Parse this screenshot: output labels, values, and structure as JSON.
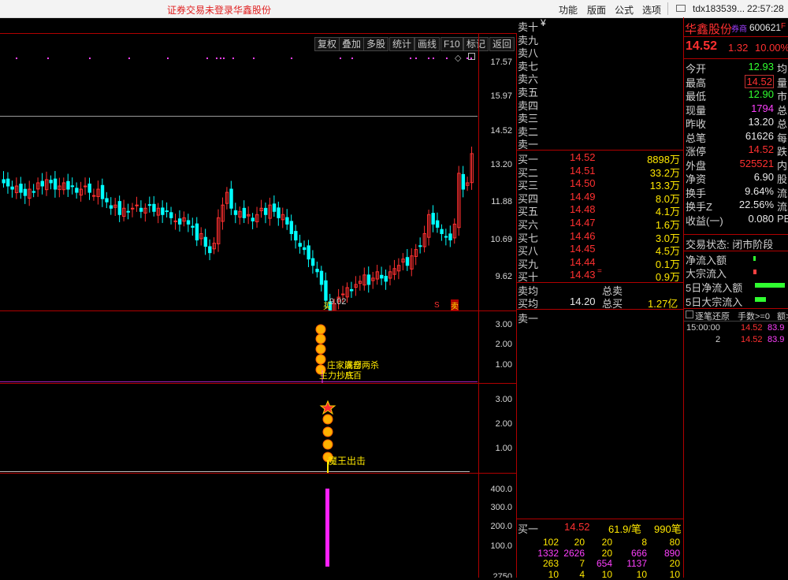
{
  "titlebar": {
    "warning": "证券交易未登录",
    "stock_name": "华鑫股份",
    "menus": [
      "功能",
      "版面",
      "公式",
      "选项"
    ],
    "account": "tdx183539...",
    "time": "22:57:28"
  },
  "toolbar": {
    "buttons": [
      "复权",
      "叠加",
      "多股",
      "统计",
      "画线",
      "F10",
      "标记",
      "返回"
    ]
  },
  "main_chart": {
    "y_ticks": [
      "17.57",
      "15.97",
      "14.52",
      "13.20",
      "11.88",
      "10.69",
      "9.62"
    ],
    "low_label": "9.02",
    "bottom_markers": [
      "S",
      "卖"
    ],
    "bottom_left_marker": "买"
  },
  "indicator1": {
    "y_ticks": [
      "3.00",
      "2.00",
      "1.00"
    ],
    "labels": [
      "庄家满仓",
      "底部两杀",
      "主力抄底",
      "八百"
    ]
  },
  "indicator2": {
    "y_ticks": [
      "3.00",
      "2.00",
      "1.00"
    ],
    "label": "魔王出击"
  },
  "volume": {
    "y_ticks": [
      "400.0",
      "300.0",
      "200.0",
      "100.0"
    ],
    "bottom_tick": "2750"
  },
  "orderbook": {
    "sell": [
      {
        "label": "卖十",
        "price": "",
        "vol": ""
      },
      {
        "label": "卖九",
        "price": "",
        "vol": ""
      },
      {
        "label": "卖八",
        "price": "",
        "vol": ""
      },
      {
        "label": "卖七",
        "price": "",
        "vol": ""
      },
      {
        "label": "卖六",
        "price": "",
        "vol": ""
      },
      {
        "label": "卖五",
        "price": "",
        "vol": ""
      },
      {
        "label": "卖四",
        "price": "",
        "vol": ""
      },
      {
        "label": "卖三",
        "price": "",
        "vol": ""
      },
      {
        "label": "卖二",
        "price": "",
        "vol": ""
      },
      {
        "label": "卖一",
        "price": "",
        "vol": ""
      }
    ],
    "sell_yen": "¥",
    "buy": [
      {
        "label": "买一",
        "price": "14.52",
        "vol": "8898万"
      },
      {
        "label": "买二",
        "price": "14.51",
        "vol": "33.2万"
      },
      {
        "label": "买三",
        "price": "14.50",
        "vol": "13.3万"
      },
      {
        "label": "买四",
        "price": "14.49",
        "vol": "8.0万"
      },
      {
        "label": "买五",
        "price": "14.48",
        "vol": "4.1万"
      },
      {
        "label": "买六",
        "price": "14.47",
        "vol": "1.6万"
      },
      {
        "label": "买七",
        "price": "14.46",
        "vol": "3.0万"
      },
      {
        "label": "买八",
        "price": "14.45",
        "vol": "4.5万"
      },
      {
        "label": "买九",
        "price": "14.44",
        "vol": "0.1万"
      },
      {
        "label": "买十",
        "price": "14.43",
        "vol": "0.9万",
        "flag": "="
      }
    ],
    "avg_sell_label": "卖均",
    "total_sell_label": "总卖",
    "avg_buy_label": "买均",
    "avg_buy_price": "14.20",
    "total_buy_label": "总买",
    "total_buy_value": "1.27亿",
    "queue_sell_label": "卖一",
    "queue_buy_label": "买一",
    "queue_buy_price": "14.52",
    "queue_buy_avg": "61.9/笔",
    "queue_buy_count": "990笔",
    "queue_rows": [
      [
        "102",
        "20",
        "20",
        "8",
        "80"
      ],
      [
        "1332",
        "2626",
        "20",
        "666",
        "890"
      ],
      [
        "263",
        "7",
        "654",
        "1137",
        "20"
      ],
      [
        "10",
        "4",
        "10",
        "10",
        "10"
      ]
    ]
  },
  "quote": {
    "name": "华鑫股份",
    "tag": "券商",
    "code": "600621",
    "code_suffix": "F",
    "price": "14.52",
    "change": "1.32",
    "pct": "10.00%",
    "rows": [
      {
        "label": "今开",
        "value": "12.93",
        "tail": "均"
      },
      {
        "label": "最高",
        "value": "14.52",
        "tail": "量"
      },
      {
        "label": "最低",
        "value": "12.90",
        "tail": "市"
      },
      {
        "label": "现量",
        "value": "1794",
        "tail": "总"
      },
      {
        "label": "昨收",
        "value": "13.20",
        "tail": "总"
      },
      {
        "label": "总笔",
        "value": "61626",
        "tail": "每"
      },
      {
        "label": "涨停",
        "value": "14.52",
        "tail": "跌"
      },
      {
        "label": "外盘",
        "value": "525521",
        "tail": "内"
      },
      {
        "label": "净资",
        "value": "6.90",
        "tail": "股"
      },
      {
        "label": "换手",
        "value": "9.64%",
        "tail": "流"
      },
      {
        "label": "换手Z",
        "value": "22.56%",
        "tail": "流"
      },
      {
        "label": "收益(一)",
        "value": "0.080",
        "tail": "PE"
      }
    ],
    "trade_status": "交易状态: 闭市阶段",
    "flows": [
      "净流入额",
      "大宗流入",
      "5日净流入额",
      "5日大宗流入"
    ],
    "tick_header": [
      "逐笔还原",
      "手数>=0",
      "额>"
    ],
    "ticks": [
      {
        "time": "15:00:00",
        "price": "14.52",
        "extra": "83.9"
      },
      {
        "time": "2",
        "price": "14.52",
        "extra": "83.9"
      }
    ]
  },
  "colors": {
    "up": "#ff3030",
    "down": "#00ffff",
    "grid": "#b00000",
    "accent": "#ffe800",
    "magenta": "#ff40ff"
  }
}
